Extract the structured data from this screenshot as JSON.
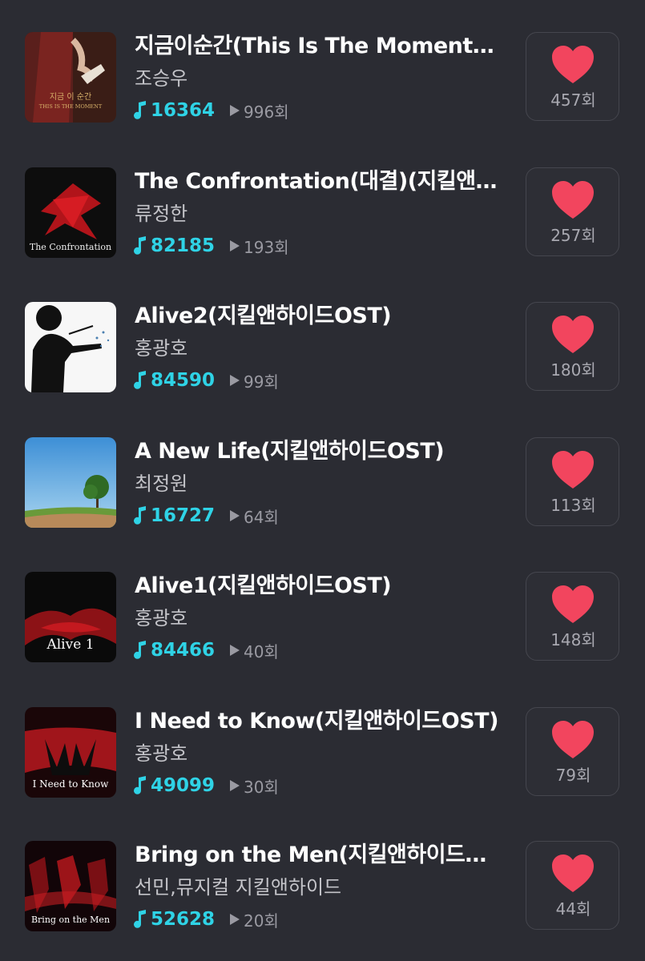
{
  "songs": [
    {
      "title": "지금이순간(This Is The Moment…",
      "artist": "조승우",
      "listens": "16364",
      "plays": "996회",
      "likes": "457회",
      "art_text": "지금 이 순간",
      "art_subtext": "THIS IS THE MOMENT"
    },
    {
      "title": "The Confrontation(대결)(지킬앤…",
      "artist": "류정한",
      "listens": "82185",
      "plays": "193회",
      "likes": "257회",
      "art_text": "The Confrontation"
    },
    {
      "title": "Alive2(지킬앤하이드OST)",
      "artist": "홍광호",
      "listens": "84590",
      "plays": "99회",
      "likes": "180회",
      "art_text": ""
    },
    {
      "title": "A New Life(지킬앤하이드OST)",
      "artist": "최정원",
      "listens": "16727",
      "plays": "64회",
      "likes": "113회",
      "art_text": ""
    },
    {
      "title": "Alive1(지킬앤하이드OST)",
      "artist": "홍광호",
      "listens": "84466",
      "plays": "40회",
      "likes": "148회",
      "art_text": "Alive 1"
    },
    {
      "title": "I Need to Know(지킬앤하이드OST)",
      "artist": "홍광호",
      "listens": "49099",
      "plays": "30회",
      "likes": "79회",
      "art_text": "I Need to Know"
    },
    {
      "title": "Bring on the Men(지킬앤하이드…",
      "artist": "선민,뮤지컬 지킬앤하이드",
      "listens": "52628",
      "plays": "20회",
      "likes": "44회",
      "art_text": "Bring on the Men"
    }
  ],
  "colors": {
    "background": "#2b2c33",
    "heart": "#f2455e",
    "listen_accent": "#2fd3e6"
  },
  "icons": {
    "listen": "music-note-icon",
    "play": "play-icon",
    "like": "heart-icon"
  }
}
